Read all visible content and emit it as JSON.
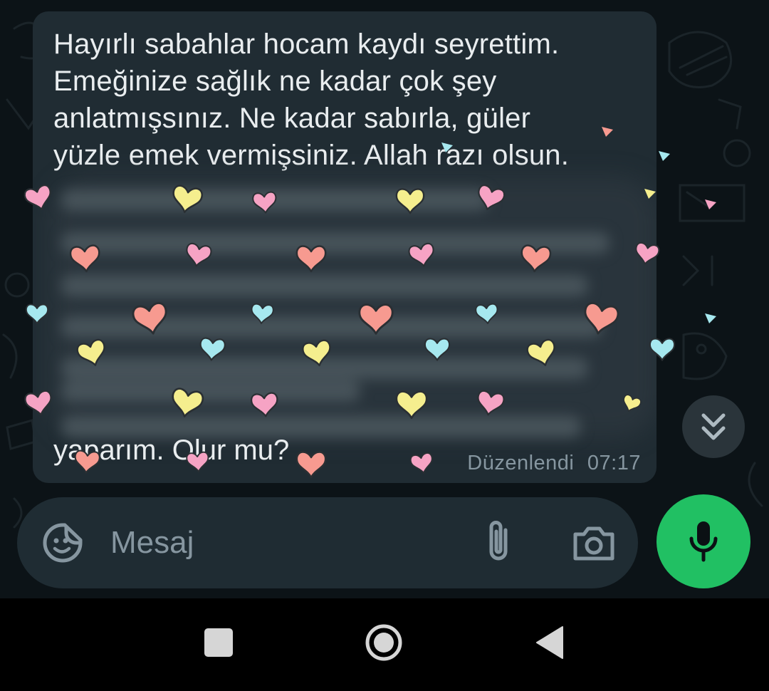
{
  "message": {
    "lines": [
      "Hayırlı sabahlar hocam kaydı seyrettim.",
      "Emeğinize sağlık ne kadar çok şey",
      "anlatmışsınız. Ne kadar sabırla, güler",
      "yüzle emek vermişsiniz. Allah razı olsun."
    ],
    "last_line": "yaparım. Olur mu?",
    "edited_label": "Düzenlendi",
    "time": "07:17"
  },
  "input": {
    "placeholder": "Mesaj"
  },
  "icons": {
    "emoji": "sticker-emoji-icon",
    "attach": "paperclip-icon",
    "camera": "camera-icon",
    "mic": "microphone-icon",
    "scroll": "double-chevron-down-icon",
    "nav_recents": "square-recents-icon",
    "nav_home": "circle-home-icon",
    "nav_back": "triangle-back-icon"
  },
  "colors": {
    "chat_background": "#0c1317",
    "bubble": "#202c33",
    "text": "#e9edef",
    "meta_text": "#8696a0",
    "input_bar": "#1f2c33",
    "mic_button": "#21c063",
    "heart_pink": "#f6a3c4",
    "heart_salmon": "#f79a90",
    "heart_yellow": "#f5ee8e",
    "heart_cyan": "#a6e8ef"
  }
}
